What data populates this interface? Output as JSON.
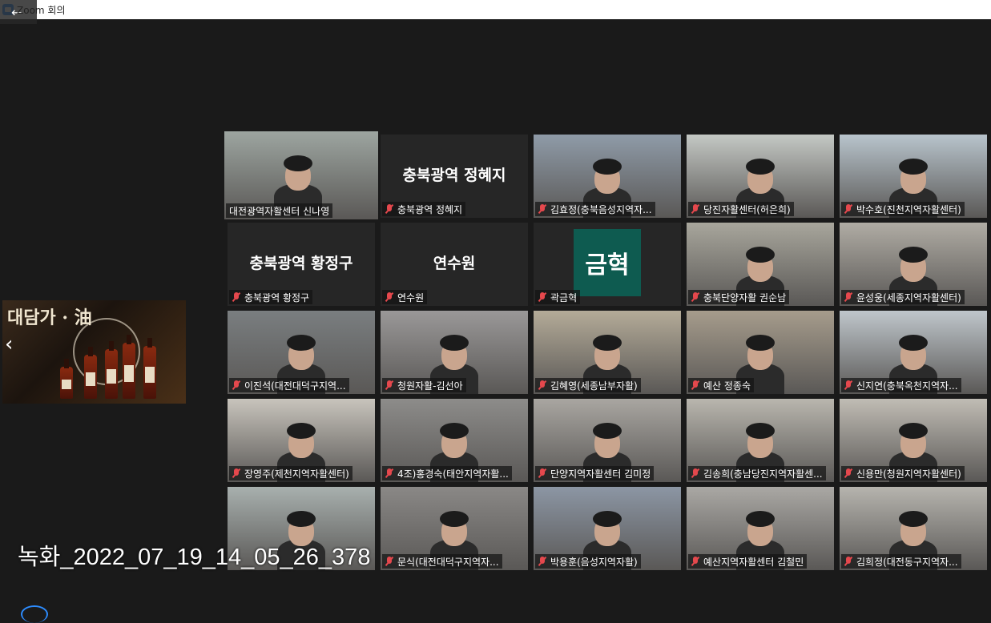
{
  "window": {
    "title": "Zoom 회의",
    "back_label": "←"
  },
  "shared_screen": {
    "brand": "대담가 · 油",
    "prev_label": "‹"
  },
  "recording_label": "녹화_2022_07_19_14_05_26_378",
  "colors": {
    "active_border": "#d6de4a",
    "mute_red": "#e5484d",
    "accent": "#2d8cff"
  },
  "participants": [
    {
      "label": "대전광역자활센터 신나영",
      "kind": "video",
      "active": true,
      "bg": "#9da5a0"
    },
    {
      "label": "충북광역 정혜지",
      "kind": "name",
      "big": "충북광역 정혜지"
    },
    {
      "label": "김효정(충북음성지역자...",
      "kind": "video",
      "bg": "#8f9ba8"
    },
    {
      "label": "당진자활센터(허은희)",
      "kind": "video",
      "bg": "#c4c8c4"
    },
    {
      "label": "박수호(진천지역자활센터)",
      "kind": "video",
      "bg": "#b8c4cc"
    },
    {
      "label": "충북광역 황정구",
      "kind": "name",
      "big": "충북광역 황정구"
    },
    {
      "label": "연수원",
      "kind": "name",
      "big": "연수원"
    },
    {
      "label": "곽금혁",
      "kind": "avatar",
      "big": "금혁"
    },
    {
      "label": "충북단양자활 권순남",
      "kind": "video",
      "bg": "#a8a69c"
    },
    {
      "label": "윤성웅(세종지역자활센터)",
      "kind": "video",
      "bg": "#b0aca4"
    },
    {
      "label": "이진석(대전대덕구지역...",
      "kind": "video",
      "bg": "#7a7e80"
    },
    {
      "label": "청원자활-김선아",
      "kind": "video",
      "bg": "#9a9898"
    },
    {
      "label": "김혜영(세종남부자활)",
      "kind": "video",
      "bg": "#b4ab98"
    },
    {
      "label": "예산 정종숙",
      "kind": "video",
      "bg": "#a69c8c"
    },
    {
      "label": "신지연(충북옥천지역자...",
      "kind": "video",
      "bg": "#bfc6cb"
    },
    {
      "label": "장영주(제천지역자활센터)",
      "kind": "video",
      "bg": "#c8c4bc"
    },
    {
      "label": "4조)홍경숙(태안지역자활...",
      "kind": "video",
      "bg": "#8d8c8a"
    },
    {
      "label": "단양지역자활센터 김미정",
      "kind": "video",
      "bg": "#a9a6a1"
    },
    {
      "label": "김송희(충남당진지역자활센...",
      "kind": "video",
      "bg": "#b9b6ae"
    },
    {
      "label": "신용만(청원지역자활센터)",
      "kind": "video",
      "bg": "#c0bcb4"
    },
    {
      "label": "",
      "kind": "video",
      "bg": "#a8b0ae"
    },
    {
      "label": "문식(대전대덕구지역자...",
      "kind": "video",
      "bg": "#8a8886"
    },
    {
      "label": "박용훈(음성지역자활)",
      "kind": "video",
      "bg": "#8c96a4"
    },
    {
      "label": "예산지역자활센터 김철민",
      "kind": "video",
      "bg": "#aaa8a4"
    },
    {
      "label": "김희정(대전동구지역자...",
      "kind": "video",
      "bg": "#b6b4ae"
    }
  ]
}
